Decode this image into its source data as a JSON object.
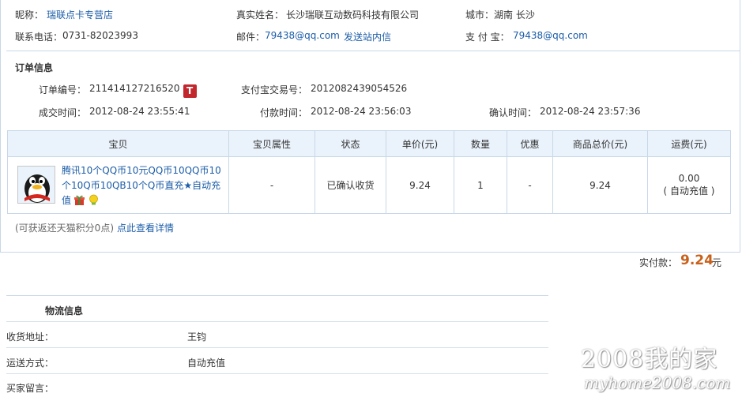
{
  "seller": {
    "nickname_label": "昵称：",
    "nickname": "瑞联点卡专营店",
    "realname_label": "真实姓名：",
    "realname": "长沙瑞联互动数码科技有限公司",
    "city_label": "城市：",
    "city": "湖南 长沙",
    "phone_label": "联系电话：",
    "phone": "0731-82023993",
    "email_label": "邮件：",
    "email": "79438@qq.com",
    "send_message": "发送站内信",
    "alipay_label": "支 付 宝：",
    "alipay": "79438@qq.com"
  },
  "order": {
    "section_title": "订单信息",
    "order_no_label": "订单编号：",
    "order_no": "211414127216520",
    "badge": "T",
    "alipay_no_label": "支付宝交易号：",
    "alipay_no": "2012082439054526",
    "deal_time_label": "成交时间：",
    "deal_time": "2012-08-24 23:55:41",
    "pay_time_label": "付款时间：",
    "pay_time": "2012-08-24 23:56:03",
    "confirm_time_label": "确认时间：",
    "confirm_time": "2012-08-24 23:57:36"
  },
  "table": {
    "headers": [
      "宝贝",
      "宝贝属性",
      "状态",
      "单价(元)",
      "数量",
      "优惠",
      "商品总价(元)",
      "运费(元)"
    ],
    "row": {
      "title": "腾讯10个QQ币10元QQ币10QQ币10个10Q币10QB10个Q币直充★自动充值",
      "attr": "-",
      "status": "已确认收货",
      "price": "9.24",
      "qty": "1",
      "discount": "-",
      "total": "9.24",
      "shipping": "0.00",
      "shipping_note": "( 自动充值 )"
    }
  },
  "points": {
    "note": "(可获返还天猫积分0点)",
    "link": "点此查看详情"
  },
  "payment": {
    "label": "实付款：",
    "amount": "9.24",
    "unit": "元"
  },
  "logistics": {
    "section_title": "物流信息",
    "rows": [
      {
        "label": "收货地址：",
        "value": "王钧"
      },
      {
        "label": "运送方式：",
        "value": "自动充值"
      },
      {
        "label": "买家留言：",
        "value": ""
      }
    ]
  },
  "watermark": {
    "line1": "2008我的家",
    "line2": "myhome2008.com"
  },
  "colors": {
    "link": "#1c5da8",
    "header_bg": "#eaf2fb",
    "border": "#c8d8e8",
    "price_orange": "#c9601a",
    "badge_red": "#c1272d"
  }
}
